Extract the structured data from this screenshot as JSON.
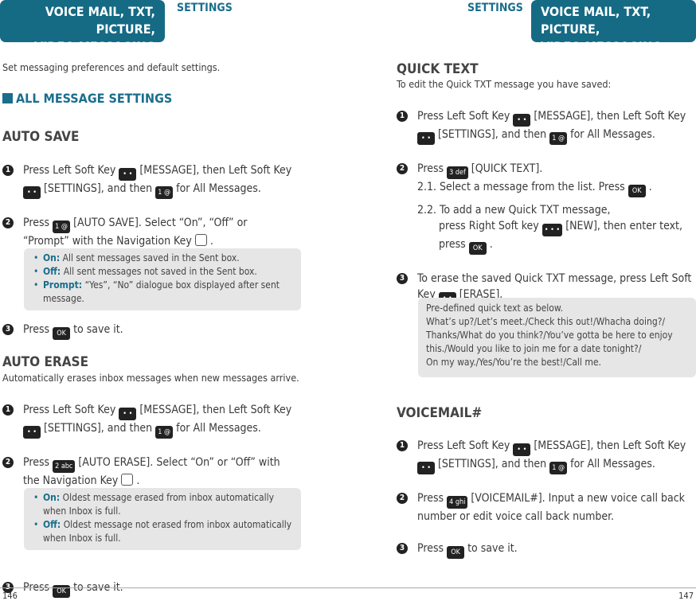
{
  "left": {
    "tab": "VOICE MAIL, TXT, PICTURE, VIDEO MESSAGING",
    "tab_line1": "VOICE MAIL, TXT, PICTURE,",
    "tab_line2": "VIDEO MESSAGING",
    "section": "SETTINGS",
    "intro": "Set messaging preferences and default settings.",
    "heading": "ALL MESSAGE SETTINGS",
    "auto_save": {
      "title": "AUTO SAVE",
      "s1a": "Press Left Soft Key",
      "s1b": "[MESSAGE], then Left Soft Key",
      "s1c": "[SETTINGS], and then",
      "s1d": "for All Messages.",
      "s2a": "Press",
      "s2b": "[AUTO SAVE]. Select “On”, “Off” or",
      "s2c": "“Prompt” with the Navigation Key",
      "s3a": "Press",
      "s3b": "to save it.",
      "note": [
        {
          "label": "On:",
          "text": "All sent messages saved in the Sent box."
        },
        {
          "label": "Off:",
          "text": "All sent messages not saved in the Sent box."
        },
        {
          "label": "Prompt:",
          "text": "“Yes”, “No” dialogue box displayed after sent message."
        }
      ]
    },
    "auto_erase": {
      "title": "AUTO ERASE",
      "desc": "Automatically erases inbox messages when new messages arrive.",
      "s1a": "Press Left Soft Key",
      "s1b": "[MESSAGE], then Left Soft Key",
      "s1c": "[SETTINGS], and then",
      "s1d": "for All Messages.",
      "s2a": "Press",
      "s2b": "[AUTO ERASE]. Select “On” or “Off” with",
      "s2c": "the Navigation Key",
      "s3a": "Press",
      "s3b": "to save it.",
      "note": [
        {
          "label": "On:",
          "text": "Oldest message erased from inbox automatically when Inbox is full."
        },
        {
          "label": "Off:",
          "text": "Oldest message not erased from inbox automatically when Inbox is full."
        }
      ]
    },
    "page": "146"
  },
  "right": {
    "tab_line1": "VOICE MAIL, TXT, PICTURE,",
    "tab_line2": "VIDEO MESSAGING",
    "section": "SETTINGS",
    "quick": {
      "title": "QUICK TEXT",
      "desc": "To edit the Quick TXT message you have saved:",
      "s1a": "Press Left Soft Key",
      "s1b": "[MESSAGE], then Left Soft Key",
      "s1c": "[SETTINGS], and then",
      "s1d": "for All Messages.",
      "s2a": "Press",
      "s2b": "[QUICK TEXT].",
      "s21": "2.1. Select a message from the list. Press",
      "s22a": "2.2. To add a new Quick TXT message,",
      "s22b": "press Right Soft key",
      "s22c": "[NEW], then enter text,",
      "s22d": "press",
      "s3a": "To erase the saved Quick TXT message, press Left Soft",
      "s3b": "Key",
      "s3c": "[ERASE].",
      "note": [
        "Pre-defined quick text as below.",
        "What’s up?/Let’s meet./Check this out!/Whacha doing?/",
        "Thanks/What do you think?/You’ve gotta be here to enjoy",
        "this./Would you like to join me for a date tonight?/",
        "On my way./Yes/You’re the best!/Call me."
      ]
    },
    "vm": {
      "title": "VOICEMAIL#",
      "s1a": "Press Left Soft Key",
      "s1b": "[MESSAGE], then Left Soft Key",
      "s1c": "[SETTINGS], and then",
      "s1d": "for All Messages.",
      "s2a": "Press",
      "s2b": "[VOICEMAIL#]. Input a new voice call back",
      "s2c": "number or edit voice call back number.",
      "s3a": "Press",
      "s3b": "to save it."
    },
    "page": "147"
  },
  "keys": {
    "soft": "• •",
    "soft3": "• • •",
    "k1": "1  @",
    "k2": "2 abc",
    "k3": "3 def",
    "k4": "4 ghi",
    "ok": "OK"
  },
  "nums": [
    "1",
    "2",
    "3"
  ],
  "colors": {
    "accent": "#156a84",
    "note_bg": "#e6e6e6"
  }
}
